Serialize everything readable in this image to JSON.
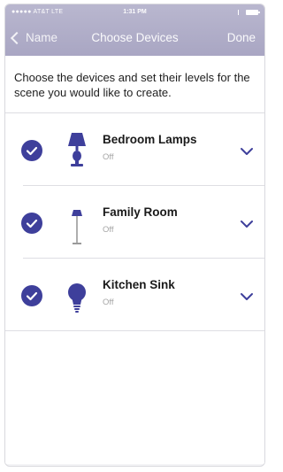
{
  "status_bar": {
    "carrier": "●●●●● AT&T  LTE",
    "time": "1:31 PM"
  },
  "nav": {
    "back_label": "Name",
    "title": "Choose Devices",
    "done_label": "Done"
  },
  "intro_text": "Choose the devices and set their levels for the scene you would like to create.",
  "colors": {
    "accent": "#3e3f9b",
    "nav_bar": "#aeabc7",
    "secondary_text": "#a6a6a6"
  },
  "devices": [
    {
      "name": "Bedroom Lamps",
      "state": "Off",
      "icon": "table-lamp-icon",
      "checked": true
    },
    {
      "name": "Family Room",
      "state": "Off",
      "icon": "floor-lamp-icon",
      "checked": true
    },
    {
      "name": "Kitchen Sink",
      "state": "Off",
      "icon": "light-bulb-icon",
      "checked": true
    }
  ]
}
